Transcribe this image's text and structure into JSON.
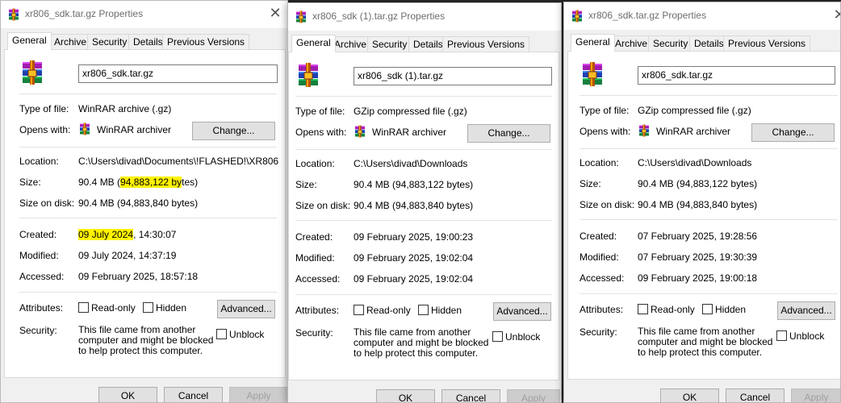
{
  "tabs": [
    "General",
    "Archive",
    "Security",
    "Details",
    "Previous Versions"
  ],
  "labels": {
    "type_of_file": "Type of file:",
    "opens_with": "Opens with:",
    "location": "Location:",
    "size": "Size:",
    "size_on_disk": "Size on disk:",
    "created": "Created:",
    "modified": "Modified:",
    "accessed": "Accessed:",
    "attributes": "Attributes:",
    "security": "Security:",
    "read_only": "Read-only",
    "hidden": "Hidden",
    "unblock": "Unblock",
    "security_text": "This file came from another computer and might be blocked to help protect this computer."
  },
  "buttons": {
    "change": "Change...",
    "advanced": "Advanced...",
    "ok": "OK",
    "cancel": "Cancel",
    "apply": "Apply"
  },
  "icons": {
    "app_icon": "winrar-books-icon",
    "close": "close-x-icon"
  },
  "colors": {
    "highlight": "#fff200",
    "title_text": "#6d6d6d"
  },
  "dialogs": [
    {
      "title": "xr806_sdk.tar.gz Properties",
      "filename": "xr806_sdk.tar.gz",
      "type_of_file": "WinRAR archive (.gz)",
      "opens_with": "WinRAR archiver",
      "location": "C:\\Users\\divad\\Documents\\!FLASHED!\\XR806",
      "size_prefix": "90.4 MB (",
      "size_highlight": "94,883,122 by",
      "size_suffix": "tes)",
      "size_on_disk": "90.4 MB (94,883,840 bytes)",
      "created_highlight": "09 July 2024",
      "created_rest": ", 14:30:07",
      "modified": "09 July 2024, 14:37:19",
      "accessed": "09 February 2025, 18:57:18"
    },
    {
      "title": "xr806_sdk (1).tar.gz Properties",
      "filename": "xr806_sdk (1).tar.gz",
      "type_of_file": "GZip compressed file (.gz)",
      "opens_with": "WinRAR archiver",
      "location": "C:\\Users\\divad\\Downloads",
      "size": "90.4 MB (94,883,122 bytes)",
      "size_on_disk": "90.4 MB (94,883,840 bytes)",
      "created": "09 February 2025, 19:00:23",
      "modified": "09 February 2025, 19:02:04",
      "accessed": "09 February 2025, 19:02:04"
    },
    {
      "title": "xr806_sdk.tar.gz Properties",
      "filename": "xr806_sdk.tar.gz",
      "type_of_file": "GZip compressed file (.gz)",
      "opens_with": "WinRAR archiver",
      "location": "C:\\Users\\divad\\Downloads",
      "size": "90.4 MB (94,883,122 bytes)",
      "size_on_disk": "90.4 MB (94,883,840 bytes)",
      "created": "07 February 2025, 19:28:56",
      "modified": "07 February 2025, 19:30:39",
      "accessed": "09 February 2025, 19:00:18"
    }
  ]
}
